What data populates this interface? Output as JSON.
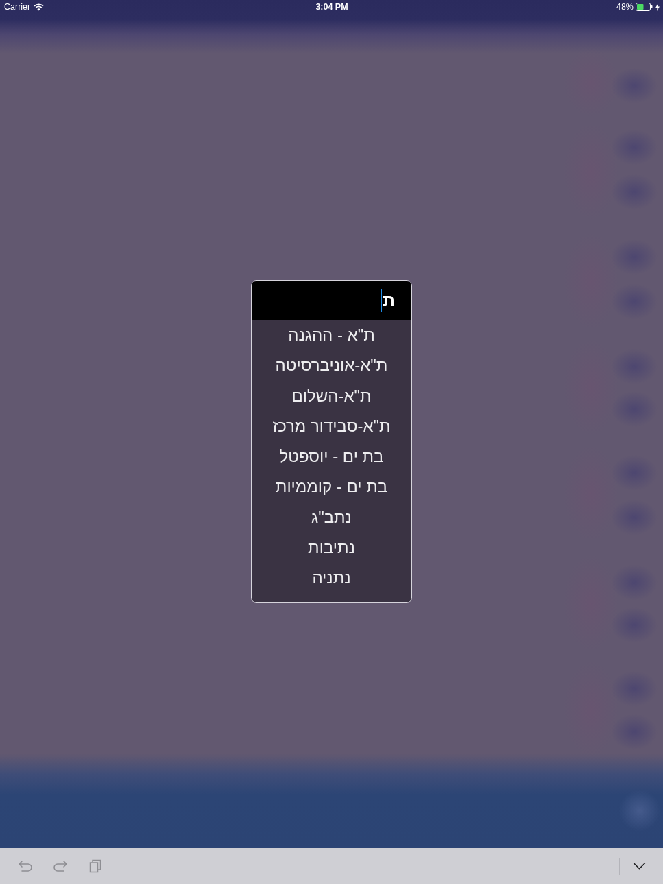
{
  "status_bar": {
    "carrier": "Carrier",
    "time": "3:04 PM",
    "battery": "48%",
    "charging": true
  },
  "search_field": {
    "value": "ת",
    "focused": true
  },
  "suggestions": [
    "ת\"א - ההגנה",
    "ת\"א-אוניברסיטה",
    "ת\"א-השלום",
    "ת\"א-סבידור מרכז",
    "בת ים - יוספטל",
    "בת ים - קוממיות",
    "נתב\"ג",
    "נתיבות",
    "נתניה"
  ]
}
